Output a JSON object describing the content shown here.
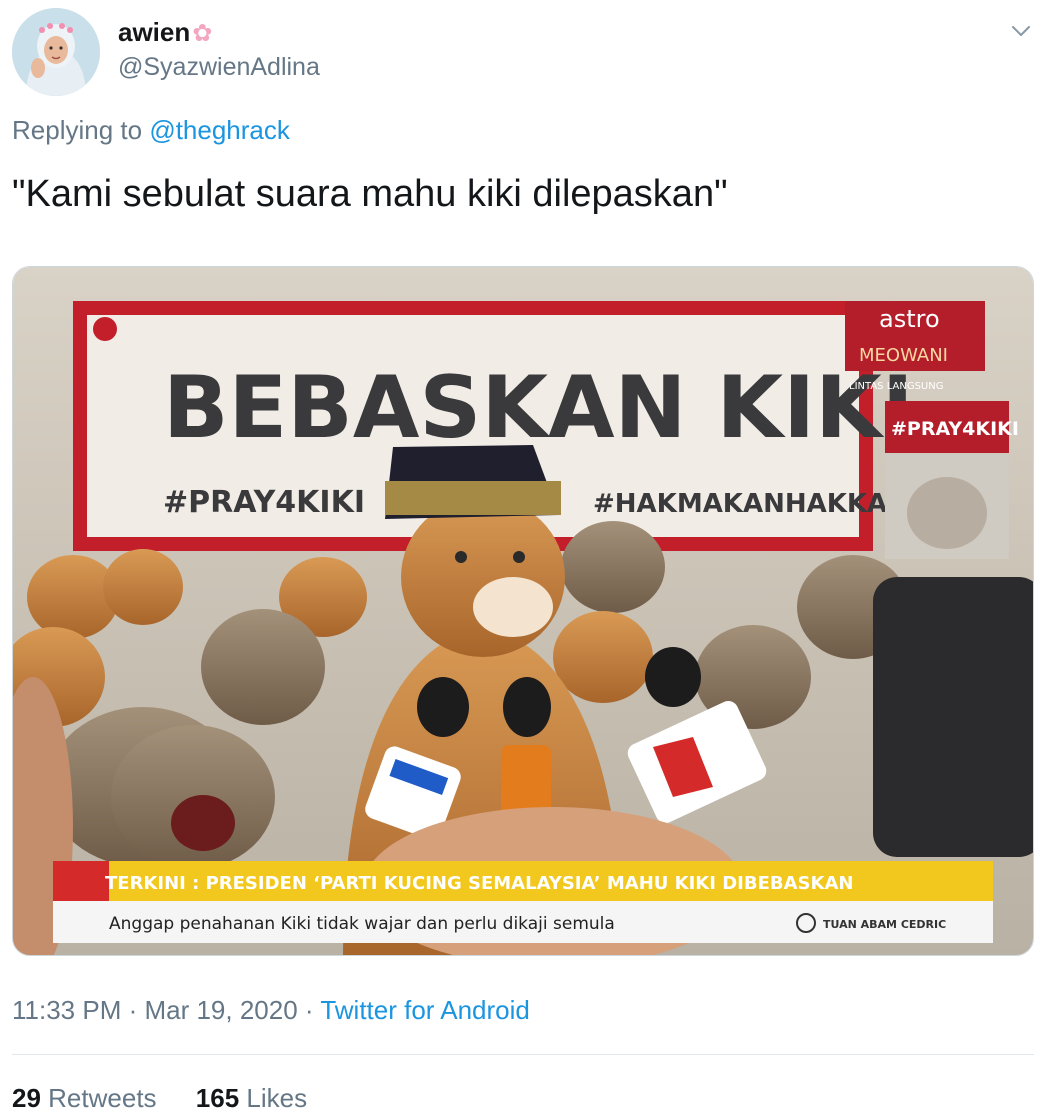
{
  "author": {
    "display_name": "awien",
    "handle": "@SyazwienAdlina"
  },
  "reply": {
    "prefix": "Replying to",
    "to": "@theghrack"
  },
  "tweet_text": "\"Kami sebulat suara mahu kiki dilepaskan\"",
  "media": {
    "banner_line1": "BEBASKAN KIKI",
    "banner_tag1": "#PRAY4KIKI",
    "banner_tag2": "#HAKMAKANHAKKAMI",
    "channel_name": "astro",
    "channel_sub": "MEOWANI",
    "channel_small": "LINTAS LANGSUNG",
    "side_tag": "#PRAY4KIKI",
    "ticker_main": "TERKINI : PRESIDEN ‘PARTI KUCING SEMALAYSIA’ MAHU KIKI DIBEBASKAN",
    "ticker_sub": "Anggap penahanan Kiki tidak wajar dan perlu dikaji semula",
    "credit": "TUAN ABAM CEDRIC"
  },
  "meta": {
    "time": "11:33 PM",
    "sep1": " · ",
    "date": "Mar 19, 2020",
    "sep2": " · ",
    "source": "Twitter for Android"
  },
  "stats": {
    "retweets_count": "29",
    "retweets_label": "Retweets",
    "likes_count": "165",
    "likes_label": "Likes"
  },
  "colors": {
    "link": "#1b95e0",
    "muted": "#657786",
    "text": "#14171a",
    "ticker_yellow": "#f2c81e",
    "ticker_red": "#d42a2a"
  }
}
